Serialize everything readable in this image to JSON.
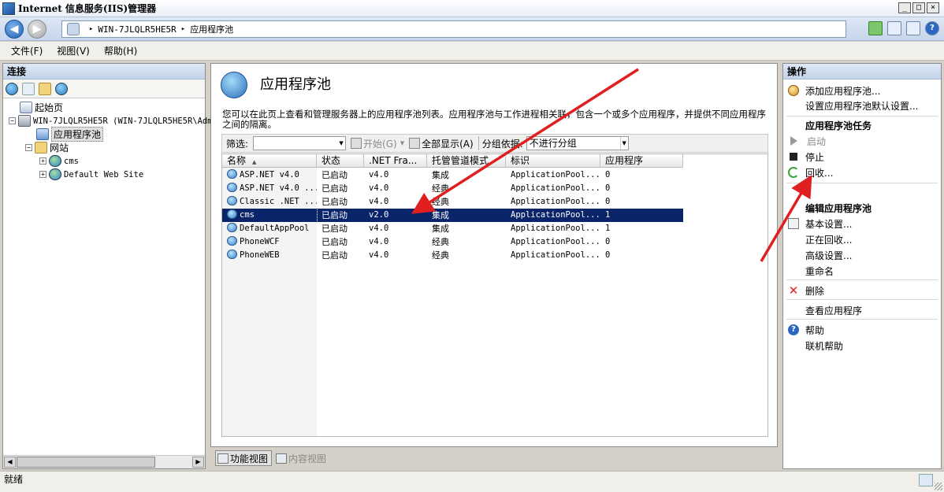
{
  "window": {
    "title": "Internet 信息服务(IIS)管理器",
    "buttons": [
      "_",
      "□",
      "×"
    ]
  },
  "address": {
    "segments": [
      "WIN-7JLQLR5HE5R",
      "应用程序池"
    ],
    "separator": "▸"
  },
  "menu": [
    "文件(F)",
    "视图(V)",
    "帮助(H)"
  ],
  "connections": {
    "header": "连接",
    "tree": {
      "start_page": "起始页",
      "server": "WIN-7JLQLR5HE5R (WIN-7JLQLR5HE5R\\Adm",
      "app_pools": "应用程序池",
      "sites": "网站",
      "site_cms": "cms",
      "site_default": "Default Web Site"
    }
  },
  "main": {
    "title": "应用程序池",
    "description": "您可以在此页上查看和管理服务器上的应用程序池列表。应用程序池与工作进程相关联，包含一个或多个应用程序，并提供不同应用程序之间的隔离。",
    "filter": {
      "label": "筛选:",
      "start_label": "开始(G)",
      "show_all_label": "全部显示(A)",
      "group_by_label": "分组依据:",
      "group_by_value": "不进行分组"
    },
    "columns": [
      "名称",
      "状态",
      ".NET Fra...",
      "托管管道模式",
      "标识",
      "应用程序"
    ],
    "rows": [
      {
        "name": "ASP.NET v4.0",
        "status": "已启动",
        "net": "v4.0",
        "mode": "集成",
        "identity": "ApplicationPool...",
        "apps": "0"
      },
      {
        "name": "ASP.NET v4.0 ...",
        "status": "已启动",
        "net": "v4.0",
        "mode": "经典",
        "identity": "ApplicationPool...",
        "apps": "0"
      },
      {
        "name": "Classic .NET ...",
        "status": "已启动",
        "net": "v4.0",
        "mode": "经典",
        "identity": "ApplicationPool...",
        "apps": "0"
      },
      {
        "name": "cms",
        "status": "已启动",
        "net": "v2.0",
        "mode": "集成",
        "identity": "ApplicationPool...",
        "apps": "1"
      },
      {
        "name": "DefaultAppPool",
        "status": "已启动",
        "net": "v4.0",
        "mode": "集成",
        "identity": "ApplicationPool...",
        "apps": "1"
      },
      {
        "name": "PhoneWCF",
        "status": "已启动",
        "net": "v4.0",
        "mode": "经典",
        "identity": "ApplicationPool...",
        "apps": "0"
      },
      {
        "name": "PhoneWEB",
        "status": "已启动",
        "net": "v4.0",
        "mode": "经典",
        "identity": "ApplicationPool...",
        "apps": "0"
      }
    ],
    "selected_row": 3,
    "view_tabs": {
      "features": "功能视图",
      "content": "内容视图"
    }
  },
  "actions": {
    "header": "操作",
    "add_pool": "添加应用程序池...",
    "set_defaults": "设置应用程序池默认设置...",
    "tasks_header": "应用程序池任务",
    "start": "启动",
    "stop": "停止",
    "recycle": "回收...",
    "edit_header": "编辑应用程序池",
    "basic_settings": "基本设置...",
    "recycling": "正在回收...",
    "advanced_settings": "高级设置...",
    "rename": "重命名",
    "delete": "删除",
    "view_apps": "查看应用程序",
    "help": "帮助",
    "online_help": "联机帮助"
  },
  "status": {
    "text": "就绪"
  },
  "colors": {
    "selection": "#0a246a",
    "annotation_arrow": "#e02020",
    "disabled_text": "#8a8a8a"
  }
}
